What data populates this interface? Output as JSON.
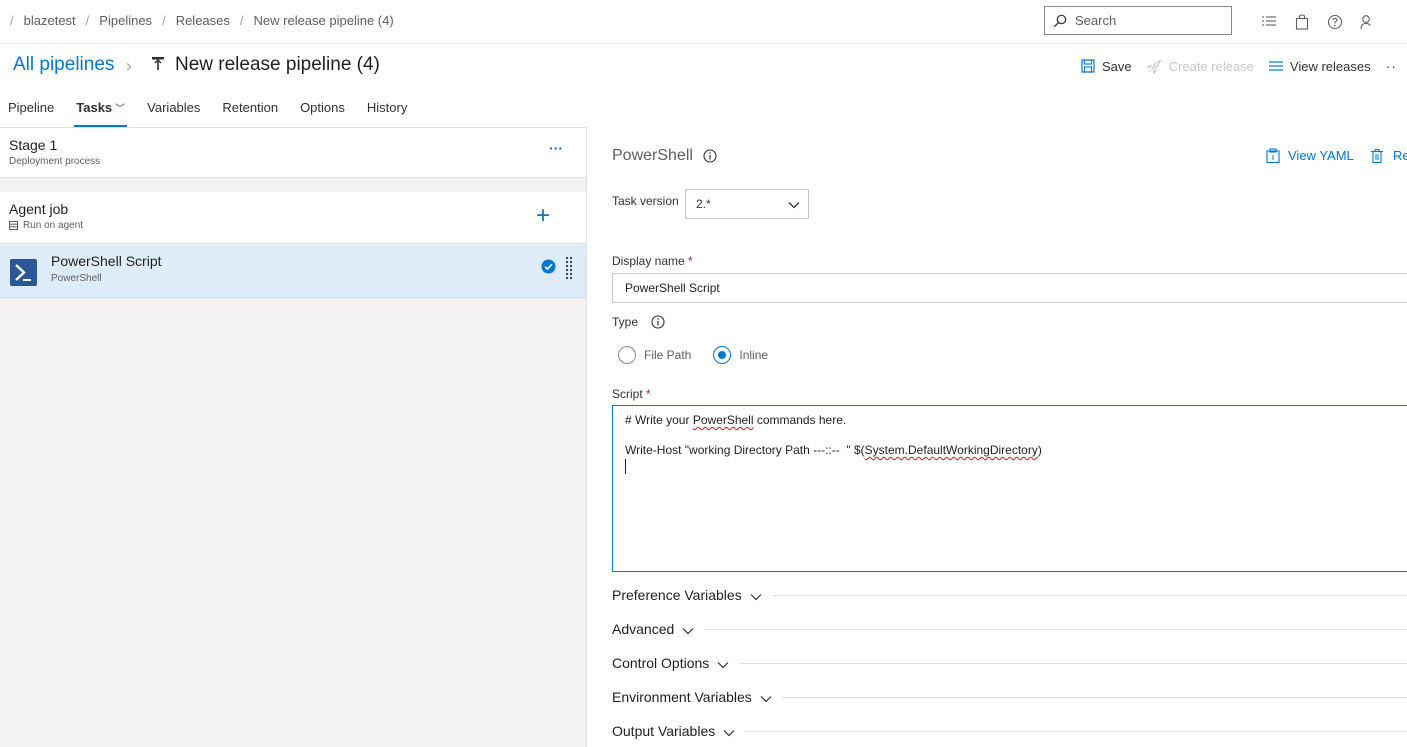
{
  "breadcrumb": {
    "items": [
      "blazetest",
      "Pipelines",
      "Releases",
      "New release pipeline (4)"
    ]
  },
  "search": {
    "placeholder": "Search"
  },
  "header": {
    "all_pipelines": "All pipelines",
    "pipeline_name": "New release pipeline (4)",
    "save": "Save",
    "create_release": "Create release",
    "view_releases": "View releases",
    "more": "··"
  },
  "tabs": [
    "Pipeline",
    "Tasks",
    "Variables",
    "Retention",
    "Options",
    "History"
  ],
  "left": {
    "stage": {
      "title": "Stage 1",
      "subtitle": "Deployment process",
      "more": "···"
    },
    "agent_job": {
      "title": "Agent job",
      "subtitle": "Run on agent",
      "add": "+"
    },
    "task": {
      "title": "PowerShell Script",
      "subtitle": "PowerShell"
    }
  },
  "right": {
    "title": "PowerShell",
    "view_yaml": "View YAML",
    "remove_initial": "Re",
    "task_version_label": "Task version",
    "task_version_value": "2.*",
    "display_name_label": "Display name",
    "required": "*",
    "display_name_value": "PowerShell Script",
    "type_label": "Type",
    "type_options": [
      "File Path",
      "Inline"
    ],
    "type_selected": "Inline",
    "script_label": "Script",
    "script": {
      "line1_pre": "# Write your ",
      "line1_squig": "PowerShell",
      "line1_post": " commands here.",
      "line2_pre": "Write-Host \"working Directory Path ---::--  \" $(",
      "line2_squig": "System.DefaultWorkingDirectory",
      "line2_post": ")"
    },
    "sections": [
      "Preference Variables",
      "Advanced",
      "Control Options",
      "Environment Variables",
      "Output Variables"
    ]
  }
}
